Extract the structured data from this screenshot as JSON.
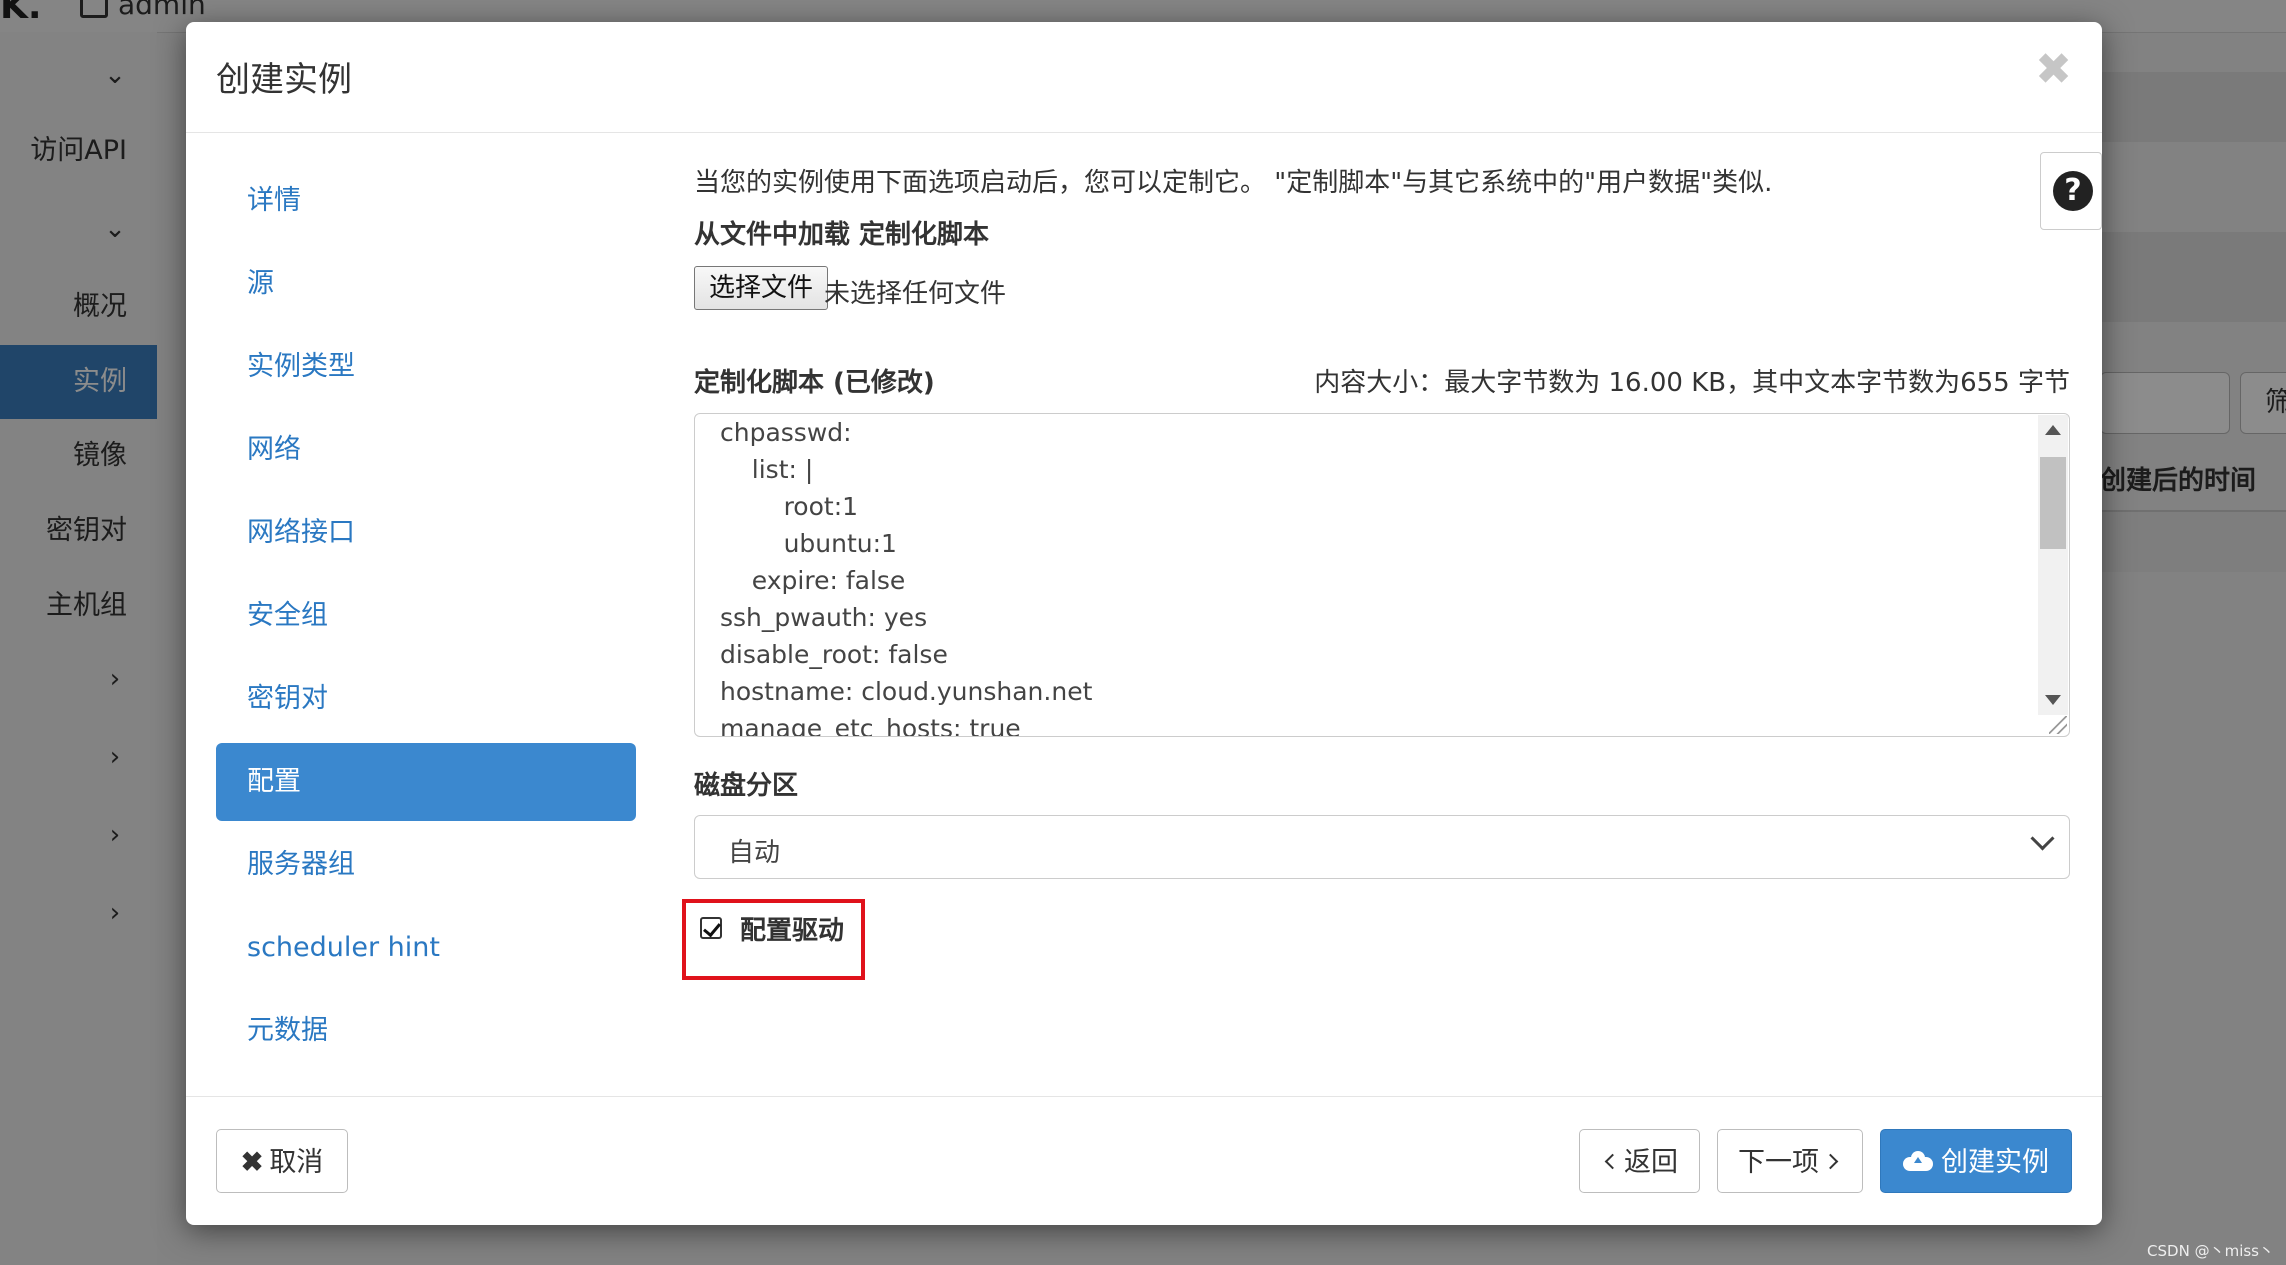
{
  "background": {
    "user": "admin",
    "sidebar": {
      "items": [
        {
          "label": "访问API"
        },
        {
          "label": "概况"
        },
        {
          "label": "实例"
        },
        {
          "label": "镜像"
        },
        {
          "label": "密钥对"
        },
        {
          "label": "主机组"
        }
      ]
    },
    "right": {
      "filter_button": "筛",
      "column_header": "创建后的时间"
    }
  },
  "modal": {
    "title": "创建实例",
    "close_glyph": "✖",
    "nav": [
      {
        "label": "详情"
      },
      {
        "label": "源"
      },
      {
        "label": "实例类型"
      },
      {
        "label": "网络"
      },
      {
        "label": "网络接口"
      },
      {
        "label": "安全组"
      },
      {
        "label": "密钥对"
      },
      {
        "label": "配置",
        "active": true
      },
      {
        "label": "服务器组"
      },
      {
        "label": "scheduler hint"
      },
      {
        "label": "元数据"
      }
    ],
    "help_glyph": "?",
    "description": "当您的实例使用下面选项启动后，您可以定制它。 \"定制脚本\"与其它系统中的\"用户数据\"类似.",
    "load_from_file_label": "从文件中加载 定制化脚本",
    "file_button": "选择文件",
    "file_status": "未选择任何文件",
    "script_label": "定制化脚本 (已修改)",
    "content_size": "内容大小：最大字节数为 16.00 KB，其中文本字节数为655 字节",
    "script_lines": [
      "chpasswd:",
      "    list: |",
      "        root:1",
      "        ubuntu:1",
      "    expire: false",
      "ssh_pwauth: yes",
      "disable_root: false",
      "hostname: cloud.yunshan.net",
      "manage_etc_hosts: true"
    ],
    "disk_partition_label": "磁盘分区",
    "disk_partition_value": "自动",
    "config_drive_label": "配置驱动",
    "config_drive_checked": true,
    "footer": {
      "cancel": "取消",
      "back": "返回",
      "next": "下一项",
      "launch": "创建实例"
    }
  },
  "watermark": "CSDN @丶miss丶"
}
